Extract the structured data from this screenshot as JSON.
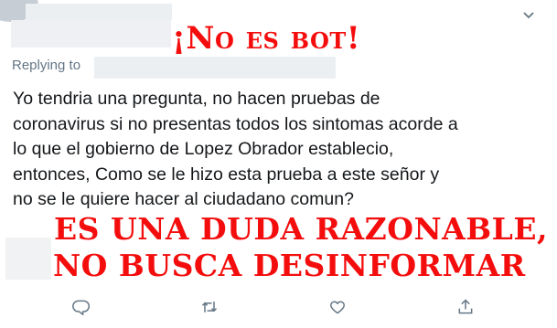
{
  "tweet": {
    "replying_label": "Replying to",
    "text": "Yo tendria una pregunta, no hacen pruebas de\ncoronavirus si no presentas todos los sintomas acorde a\nlo que el gobierno de Lopez Obrador establecio,\nentonces, Como se le hizo esta prueba a este señor y\nno se le quiere hacer al ciudadano comun?"
  },
  "annotations": {
    "title": "¡No es bot!",
    "line1": "ES UNA DUDA RAZONABLE,",
    "line2": "NO BUSCA DESINFORMAR",
    "color": "#f40d0d"
  },
  "icons": {
    "more": "chevron-down-icon",
    "reply": "reply-icon",
    "retweet": "retweet-icon",
    "like": "like-icon",
    "share": "share-icon"
  },
  "colors": {
    "text": "#14171a",
    "secondary": "#657786"
  }
}
